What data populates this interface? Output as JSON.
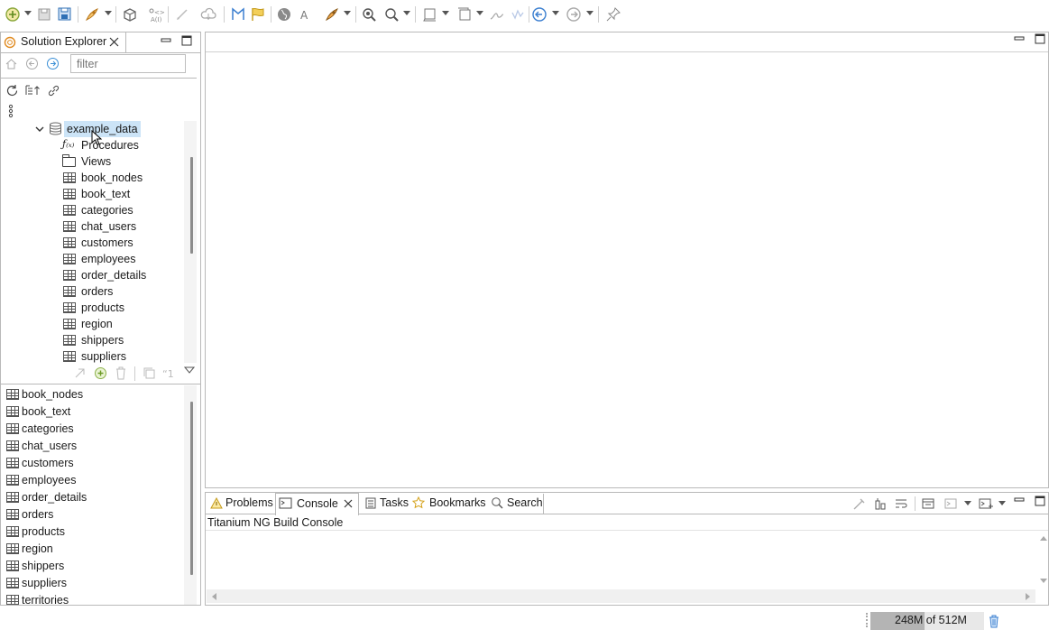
{
  "toolbar": {
    "icons": [
      "new-icon",
      "save-icon",
      "save-all-icon",
      "run-icon",
      "package-icon",
      "debug-icon",
      "clean-icon",
      "cloud-icon",
      "bridge-icon",
      "flag-icon",
      "globe-icon",
      "text-icon",
      "deploy-icon",
      "zoom-icon",
      "search-icon",
      "perspective-icon",
      "window-icon",
      "sign-icon",
      "sign2-icon",
      "back-icon",
      "forward-icon",
      "pin-icon"
    ]
  },
  "solution_explorer": {
    "title": "Solution Explorer",
    "filter_placeholder": "filter",
    "root": "example_data",
    "tree_items": [
      {
        "label": "Procedures",
        "icon": "function-icon"
      },
      {
        "label": "Views",
        "icon": "folder-icon"
      },
      {
        "label": "book_nodes",
        "icon": "table-icon"
      },
      {
        "label": "book_text",
        "icon": "table-icon"
      },
      {
        "label": "categories",
        "icon": "table-icon"
      },
      {
        "label": "chat_users",
        "icon": "table-icon"
      },
      {
        "label": "customers",
        "icon": "table-icon"
      },
      {
        "label": "employees",
        "icon": "table-icon"
      },
      {
        "label": "order_details",
        "icon": "table-icon"
      },
      {
        "label": "orders",
        "icon": "table-icon"
      },
      {
        "label": "products",
        "icon": "table-icon"
      },
      {
        "label": "region",
        "icon": "table-icon"
      },
      {
        "label": "shippers",
        "icon": "table-icon"
      },
      {
        "label": "suppliers",
        "icon": "table-icon"
      }
    ],
    "list_items": [
      "book_nodes",
      "book_text",
      "categories",
      "chat_users",
      "customers",
      "employees",
      "order_details",
      "orders",
      "products",
      "region",
      "shippers",
      "suppliers",
      "territories"
    ]
  },
  "bottom_panel": {
    "tabs": [
      "Problems",
      "Console",
      "Tasks",
      "Bookmarks",
      "Search"
    ],
    "active_tab": "Console",
    "console_title": "Titanium NG Build Console"
  },
  "status_bar": {
    "memory": "248M of 512M",
    "memory_used_fraction": 0.48
  }
}
